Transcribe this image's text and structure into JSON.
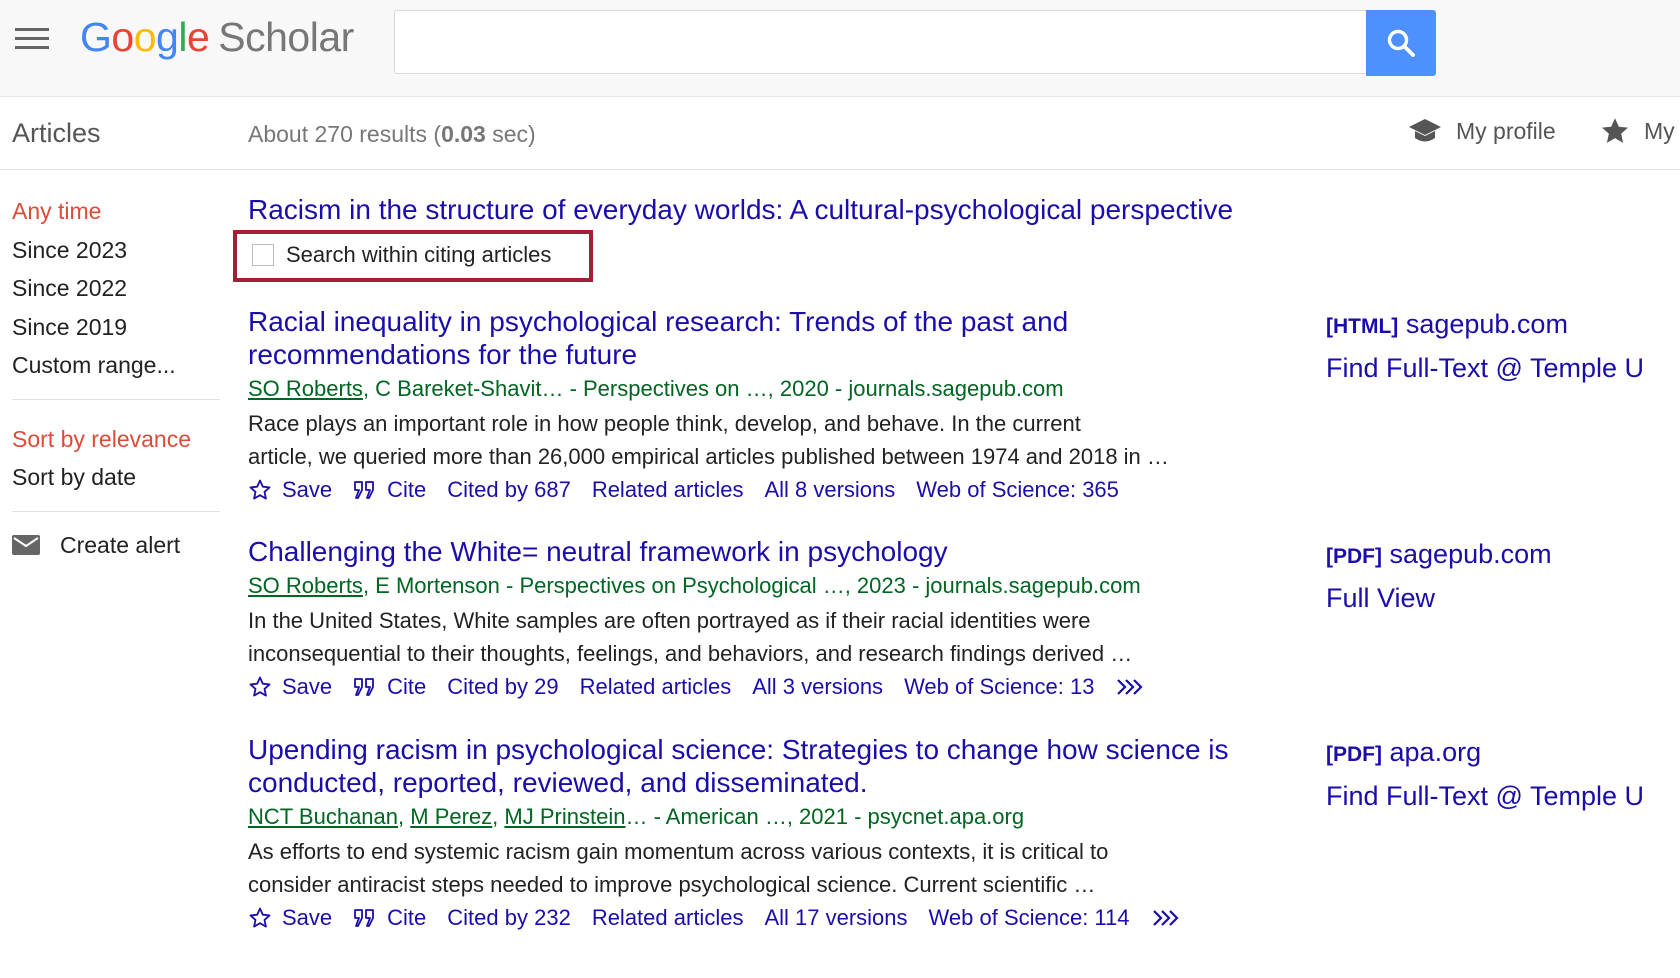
{
  "header": {
    "logo_letters": [
      "G",
      "o",
      "o",
      "g",
      "l",
      "e"
    ],
    "logo_suffix": "Scholar",
    "search_value": "",
    "search_placeholder": ""
  },
  "subbar": {
    "section_label": "Articles",
    "results_prefix": "About 270 results (",
    "results_time": "0.03",
    "results_suffix": " sec)",
    "my_profile": "My profile",
    "my_library": "My"
  },
  "sidebar": {
    "time_filters": [
      "Any time",
      "Since 2023",
      "Since 2022",
      "Since 2019",
      "Custom range..."
    ],
    "active_time": "Any time",
    "sort_options": [
      "Sort by relevance",
      "Sort by date"
    ],
    "active_sort": "Sort by relevance",
    "create_alert": "Create alert"
  },
  "citing": {
    "title": "Racism in the structure of everyday worlds: A cultural-psychological perspective",
    "checkbox_label": "Search within citing articles"
  },
  "results": [
    {
      "title": "Racial inequality in psychological research: Trends of the past and recommendations for the future",
      "authors_linked": [
        "SO Roberts"
      ],
      "authors_rest": ", C Bareket-Shavit… - Perspectives on …, 2020 - journals.sagepub.com",
      "snippet_lines": [
        "Race plays an important role in how people think, develop, and behave. In the current",
        "article, we queried more than 26,000 empirical articles published between 1974 and 2018 in …"
      ],
      "save": "Save",
      "cite": "Cite",
      "cited_by": "Cited by 687",
      "related": "Related articles",
      "versions": "All 8 versions",
      "wos": "Web of Science: 365",
      "has_more": false,
      "side_format": "[HTML]",
      "side_source": "sagepub.com",
      "side_full": "Find Full-Text @ Temple U"
    },
    {
      "title": "Challenging the White= neutral framework in psychology",
      "authors_linked": [
        "SO Roberts"
      ],
      "authors_rest": ", E Mortenson - Perspectives on Psychological …, 2023 - journals.sagepub.com",
      "snippet_lines": [
        "In the United States, White samples are often portrayed as if their racial identities were",
        "inconsequential to their thoughts, feelings, and behaviors, and research findings derived …"
      ],
      "save": "Save",
      "cite": "Cite",
      "cited_by": "Cited by 29",
      "related": "Related articles",
      "versions": "All 3 versions",
      "wos": "Web of Science: 13",
      "has_more": true,
      "side_format": "[PDF]",
      "side_source": "sagepub.com",
      "side_full": "Full View"
    },
    {
      "title": "Upending racism in psychological science: Strategies to change how science is conducted, reported, reviewed, and disseminated.",
      "authors_linked": [
        "NCT Buchanan",
        "M Perez",
        "MJ Prinstein"
      ],
      "authors_rest": "… - American …, 2021 - psycnet.apa.org",
      "snippet_lines": [
        "As efforts to end systemic racism gain momentum across various contexts, it is critical to",
        "consider antiracist steps needed to improve psychological science. Current scientific …"
      ],
      "save": "Save",
      "cite": "Cite",
      "cited_by": "Cited by 232",
      "related": "Related articles",
      "versions": "All 17 versions",
      "wos": "Web of Science: 114",
      "has_more": true,
      "side_format": "[PDF]",
      "side_source": "apa.org",
      "side_full": "Find Full-Text @ Temple U"
    }
  ]
}
